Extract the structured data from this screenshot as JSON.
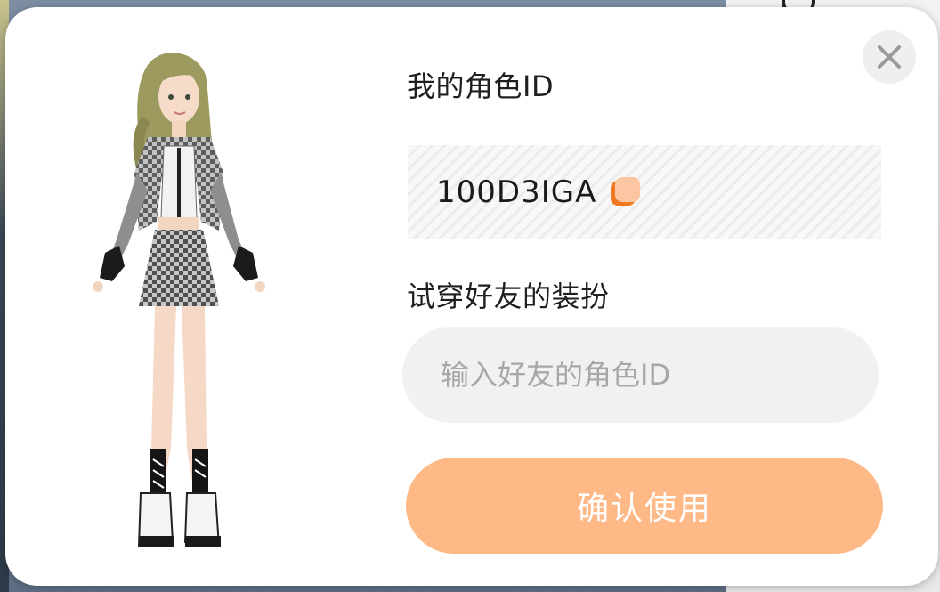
{
  "dialog": {
    "my_id_label": "我的角色ID",
    "my_id_value": "100D3IGA",
    "try_friend_label": "试穿好友的装扮",
    "friend_id_placeholder": "输入好友的角色ID",
    "friend_id_value": "",
    "confirm_label": "确认使用"
  },
  "icons": {
    "close": "close-icon",
    "copy": "copy-icon"
  },
  "colors": {
    "accent_orange": "#f07a24",
    "confirm_disabled": "#ffb987",
    "input_bg": "#f1f1f1"
  }
}
